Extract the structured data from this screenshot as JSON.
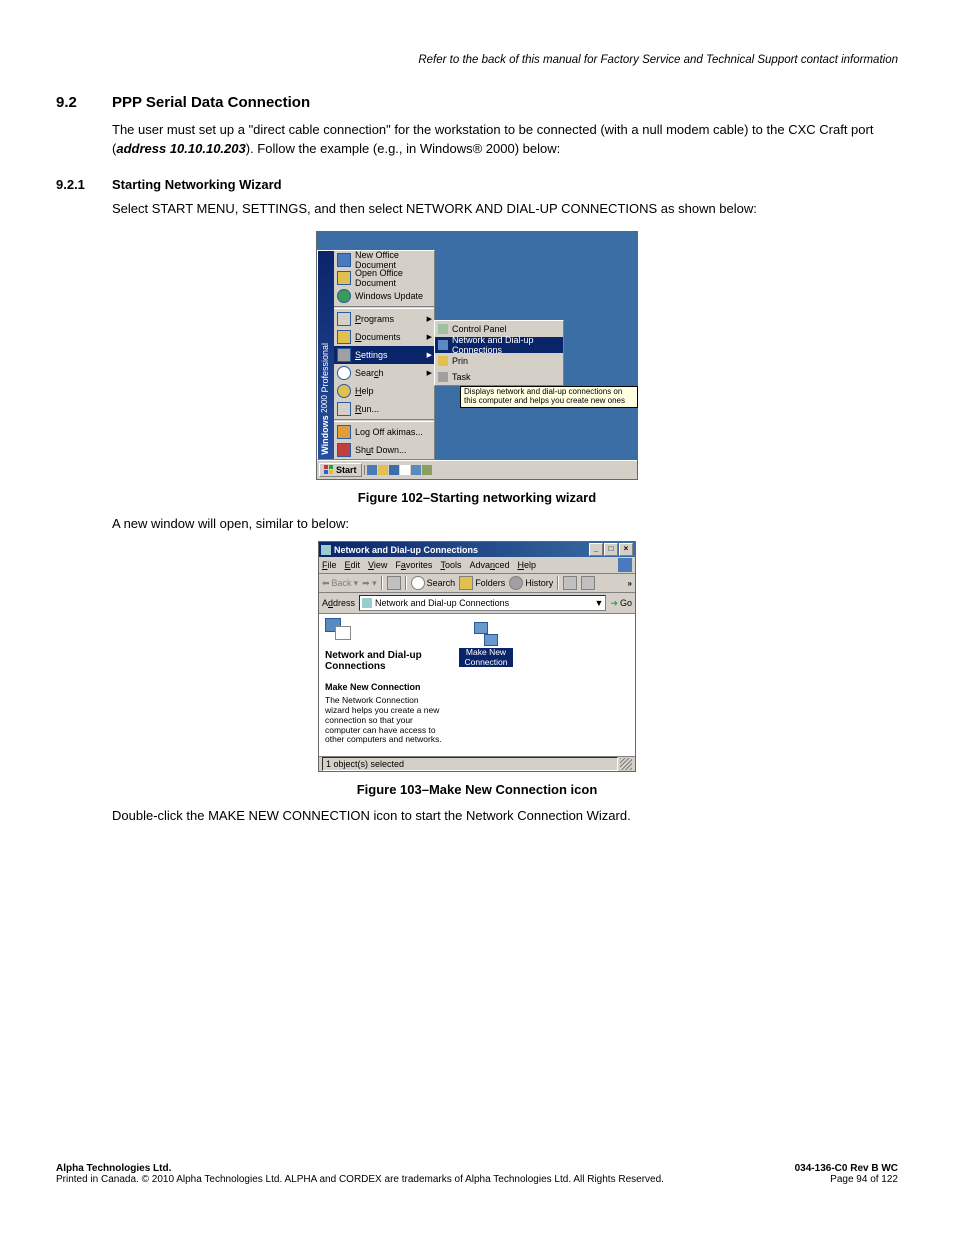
{
  "header_note": "Refer to the back of this manual for Factory Service and Technical Support contact information",
  "section": {
    "number": "9.2",
    "title": "PPP Serial Data Connection",
    "para1_pre": "The user must set up a \"direct cable connection\" for the workstation to be connected (with a null modem cable) to the CXC Craft port (",
    "address": "address 10.10.10.203",
    "para1_post": "). Follow the example (e.g., in Windows® 2000) below:"
  },
  "subsection": {
    "number": "9.2.1",
    "title": "Starting Networking Wizard",
    "para": "Select START MENU, SETTINGS, and then select NETWORK AND DIAL-UP CONNECTIONS as shown below:"
  },
  "startmenu": {
    "sidebar_brand": "Windows",
    "sidebar_edition": "2000",
    "sidebar_suffix": "Professional",
    "items": [
      {
        "label": "New Office Document"
      },
      {
        "label": "Open Office Document"
      },
      {
        "label": "Windows Update"
      },
      {
        "label": "Programs",
        "arrow": true
      },
      {
        "label": "Documents",
        "arrow": true
      },
      {
        "label": "Settings",
        "arrow": true,
        "selected": true
      },
      {
        "label": "Search",
        "arrow": true
      },
      {
        "label": "Help"
      },
      {
        "label": "Run..."
      },
      {
        "label": "Log Off akimas..."
      },
      {
        "label": "Shut Down..."
      }
    ],
    "submenu": [
      {
        "label": "Control Panel"
      },
      {
        "label": "Network and Dial-up Connections",
        "selected": true
      },
      {
        "label": "Printers"
      },
      {
        "label": "Taskbar & Start Menu..."
      }
    ],
    "tooltip": "Displays network and dial-up connections on this computer and helps you create new ones",
    "taskbar": {
      "start": "Start"
    }
  },
  "fig102": "Figure 102–Starting networking wizard",
  "mid_para": "A new window will open, similar to below:",
  "ncwindow": {
    "title": "Network and Dial-up Connections",
    "menus": [
      "File",
      "Edit",
      "View",
      "Favorites",
      "Tools",
      "Advanced",
      "Help"
    ],
    "toolbar": {
      "back": "Back",
      "search": "Search",
      "folders": "Folders",
      "history": "History"
    },
    "address_label": "Address",
    "address_value": "Network and Dial-up Connections",
    "go": "Go",
    "left": {
      "title": "Network and Dial-up Connections",
      "subtitle": "Make New Connection",
      "desc": "The Network Connection wizard helps you create a new connection so that your computer can have access to other computers and networks."
    },
    "icon_label": "Make New Connection",
    "status": "1 object(s) selected"
  },
  "fig103": "Figure 103–Make New Connection icon",
  "final_para": "Double-click the MAKE NEW CONNECTION icon to start the Network Connection Wizard.",
  "footer": {
    "company": "Alpha Technologies Ltd.",
    "copyright": "Printed in Canada.  © 2010 Alpha Technologies Ltd.  ALPHA and CORDEX are trademarks of Alpha Technologies Ltd.  All Rights Reserved.",
    "doc_id": "034-136-C0  Rev B  WC",
    "page": "Page 94 of 122"
  }
}
